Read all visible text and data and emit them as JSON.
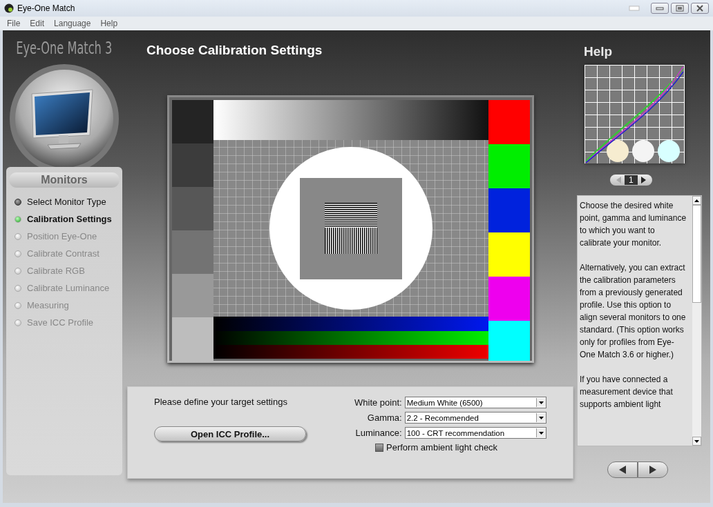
{
  "window": {
    "title": "Eye-One Match"
  },
  "menu": [
    "File",
    "Edit",
    "Language",
    "Help"
  ],
  "logo": "Eye-One Match 3",
  "section": "Monitors",
  "steps": [
    {
      "label": "Select Monitor Type",
      "completed": true,
      "selected": false
    },
    {
      "label": "Calibration Settings",
      "completed": false,
      "selected": true
    },
    {
      "label": "Position Eye-One",
      "completed": false,
      "selected": false
    },
    {
      "label": "Calibrate Contrast",
      "completed": false,
      "selected": false
    },
    {
      "label": "Calibrate RGB",
      "completed": false,
      "selected": false
    },
    {
      "label": "Calibrate Luminance",
      "completed": false,
      "selected": false
    },
    {
      "label": "Measuring",
      "completed": false,
      "selected": false
    },
    {
      "label": "Save ICC Profile",
      "completed": false,
      "selected": false
    }
  ],
  "page_title": "Choose Calibration Settings",
  "settings": {
    "prompt": "Please define your target settings",
    "open_button": "Open ICC Profile...",
    "fields": [
      {
        "label": "White point:",
        "value": "Medium White (6500)"
      },
      {
        "label": "Gamma:",
        "value": "2.2 - Recommended"
      },
      {
        "label": "Luminance:",
        "value": "100 - CRT recommendation"
      }
    ],
    "ambient": {
      "label": "Perform ambient light check",
      "checked": false
    }
  },
  "help": {
    "title": "Help",
    "page": "1",
    "paragraphs": [
      "Choose the desired white point, gamma and luminance to which you want to calibrate your monitor.",
      "Alternatively, you can extract the calibration parameters from a previously generated profile. Use this option to align several monitors to one standard. (This option works only for profiles from Eye-One Match 3.6 or higher.)",
      "If you have connected a measurement device that supports ambient light"
    ]
  }
}
